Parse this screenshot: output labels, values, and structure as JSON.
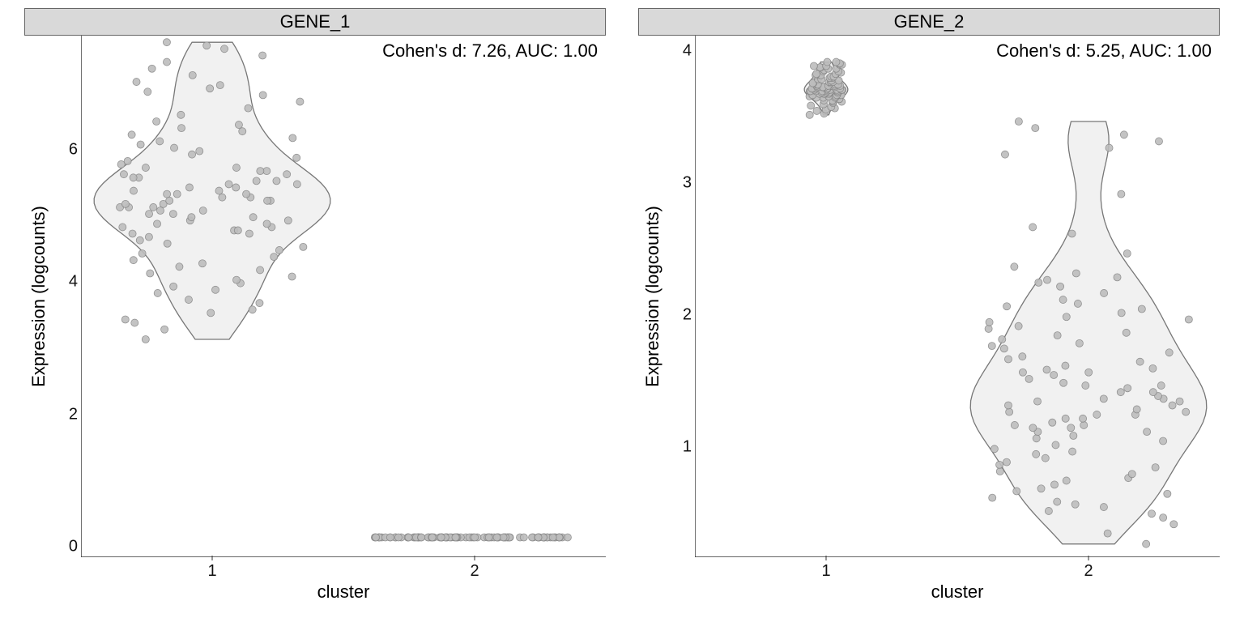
{
  "chart_data": [
    {
      "type": "violin_jitter",
      "facet_label": "GENE_1",
      "xlabel": "cluster",
      "ylabel": "Expression (logcounts)",
      "x_categories": [
        "1",
        "2"
      ],
      "y_ticks": [
        0,
        2,
        4,
        6
      ],
      "y_range": [
        -0.3,
        7.6
      ],
      "annotation": "Cohen's d: 7.26, AUC: 1.00",
      "cohens_d": 7.26,
      "auc": 1.0,
      "series": [
        {
          "name": "cluster 1",
          "n": 100,
          "summary": {
            "min": 3.0,
            "q1": 4.2,
            "median": 5.0,
            "q3": 5.6,
            "max": 7.5,
            "mean": 5.0,
            "sd": 0.9
          },
          "values": [
            3.0,
            3.15,
            3.25,
            3.3,
            3.4,
            3.45,
            3.55,
            3.6,
            3.7,
            3.75,
            3.8,
            3.85,
            3.9,
            3.95,
            4.0,
            4.05,
            4.1,
            4.15,
            4.2,
            4.25,
            4.3,
            4.35,
            4.4,
            4.45,
            4.5,
            4.55,
            4.6,
            4.6,
            4.65,
            4.65,
            4.7,
            4.7,
            4.75,
            4.75,
            4.8,
            4.8,
            4.85,
            4.85,
            4.9,
            4.9,
            4.95,
            4.95,
            5.0,
            5.0,
            5.0,
            5.05,
            5.05,
            5.1,
            5.1,
            5.1,
            5.15,
            5.15,
            5.2,
            5.2,
            5.2,
            5.25,
            5.25,
            5.3,
            5.3,
            5.35,
            5.35,
            5.4,
            5.4,
            5.45,
            5.45,
            5.5,
            5.5,
            5.55,
            5.55,
            5.6,
            5.6,
            5.65,
            5.7,
            5.75,
            5.8,
            5.85,
            5.9,
            5.95,
            6.0,
            6.05,
            6.1,
            6.15,
            6.2,
            6.25,
            6.3,
            6.4,
            6.5,
            6.6,
            6.7,
            6.75,
            6.8,
            6.85,
            6.9,
            7.0,
            7.1,
            7.2,
            7.3,
            7.4,
            7.45,
            7.5
          ]
        },
        {
          "name": "cluster 2",
          "n": 100,
          "summary": {
            "min": 0,
            "q1": 0,
            "median": 0,
            "q3": 0,
            "max": 0,
            "mean": 0,
            "sd": 0
          },
          "values": [
            0,
            0,
            0,
            0,
            0,
            0,
            0,
            0,
            0,
            0,
            0,
            0,
            0,
            0,
            0,
            0,
            0,
            0,
            0,
            0,
            0,
            0,
            0,
            0,
            0,
            0,
            0,
            0,
            0,
            0,
            0,
            0,
            0,
            0,
            0,
            0,
            0,
            0,
            0,
            0,
            0,
            0,
            0,
            0,
            0,
            0,
            0,
            0,
            0,
            0,
            0,
            0,
            0,
            0,
            0,
            0,
            0,
            0,
            0,
            0,
            0,
            0,
            0,
            0,
            0,
            0,
            0,
            0,
            0,
            0,
            0,
            0,
            0,
            0,
            0,
            0,
            0,
            0,
            0,
            0,
            0,
            0,
            0,
            0,
            0,
            0,
            0,
            0,
            0,
            0,
            0,
            0,
            0,
            0,
            0,
            0,
            0,
            0,
            0,
            0
          ]
        }
      ]
    },
    {
      "type": "violin_jitter",
      "facet_label": "GENE_2",
      "xlabel": "cluster",
      "ylabel": "Expression (logcounts)",
      "x_categories": [
        "1",
        "2"
      ],
      "y_ticks": [
        1,
        2,
        3,
        4
      ],
      "y_range": [
        0.1,
        4.05
      ],
      "annotation": "Cohen's d: 5.25, AUC: 1.00",
      "cohens_d": 5.25,
      "auc": 1.0,
      "series": [
        {
          "name": "cluster 1",
          "n": 100,
          "summary": {
            "min": 3.45,
            "q1": 3.58,
            "median": 3.63,
            "q3": 3.68,
            "max": 3.85,
            "mean": 3.63,
            "sd": 0.08
          },
          "values": [
            3.45,
            3.46,
            3.48,
            3.49,
            3.5,
            3.51,
            3.52,
            3.53,
            3.54,
            3.55,
            3.55,
            3.56,
            3.56,
            3.57,
            3.57,
            3.58,
            3.58,
            3.58,
            3.59,
            3.59,
            3.59,
            3.6,
            3.6,
            3.6,
            3.6,
            3.61,
            3.61,
            3.61,
            3.61,
            3.62,
            3.62,
            3.62,
            3.62,
            3.62,
            3.63,
            3.63,
            3.63,
            3.63,
            3.63,
            3.63,
            3.63,
            3.64,
            3.64,
            3.64,
            3.64,
            3.64,
            3.64,
            3.65,
            3.65,
            3.65,
            3.65,
            3.65,
            3.66,
            3.66,
            3.66,
            3.66,
            3.66,
            3.67,
            3.67,
            3.67,
            3.67,
            3.67,
            3.68,
            3.68,
            3.68,
            3.68,
            3.69,
            3.69,
            3.69,
            3.7,
            3.7,
            3.7,
            3.71,
            3.71,
            3.72,
            3.72,
            3.73,
            3.73,
            3.74,
            3.74,
            3.75,
            3.75,
            3.76,
            3.76,
            3.77,
            3.78,
            3.78,
            3.79,
            3.8,
            3.8,
            3.81,
            3.81,
            3.82,
            3.82,
            3.83,
            3.83,
            3.84,
            3.84,
            3.85,
            3.85
          ]
        },
        {
          "name": "cluster 2",
          "n": 100,
          "summary": {
            "min": 0.2,
            "q1": 0.85,
            "median": 1.25,
            "q3": 1.75,
            "max": 3.4,
            "mean": 1.35,
            "sd": 0.6
          },
          "values": [
            0.2,
            0.28,
            0.35,
            0.4,
            0.43,
            0.45,
            0.48,
            0.5,
            0.52,
            0.55,
            0.58,
            0.6,
            0.62,
            0.65,
            0.68,
            0.7,
            0.73,
            0.75,
            0.78,
            0.8,
            0.82,
            0.85,
            0.88,
            0.9,
            0.92,
            0.95,
            0.98,
            1.0,
            1.02,
            1.05,
            1.05,
            1.08,
            1.08,
            1.1,
            1.1,
            1.12,
            1.15,
            1.15,
            1.18,
            1.18,
            1.2,
            1.2,
            1.22,
            1.25,
            1.25,
            1.28,
            1.28,
            1.3,
            1.3,
            1.32,
            1.35,
            1.35,
            1.38,
            1.4,
            1.4,
            1.42,
            1.45,
            1.48,
            1.5,
            1.5,
            1.52,
            1.53,
            1.55,
            1.58,
            1.6,
            1.62,
            1.65,
            1.68,
            1.7,
            1.72,
            1.75,
            1.78,
            1.8,
            1.83,
            1.85,
            1.88,
            1.9,
            1.92,
            1.95,
            1.98,
            2.0,
            2.02,
            2.05,
            2.1,
            2.15,
            2.18,
            2.2,
            2.22,
            2.25,
            2.3,
            2.4,
            2.55,
            2.6,
            2.85,
            3.15,
            3.2,
            3.25,
            3.3,
            3.35,
            3.4
          ]
        }
      ]
    }
  ]
}
